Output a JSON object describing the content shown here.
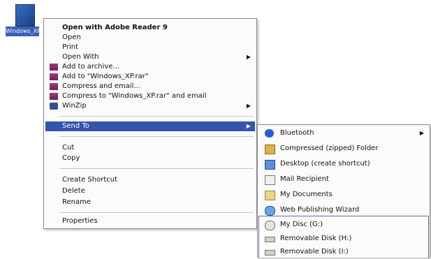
{
  "desktop_icon": {
    "label": "Windows_XP"
  },
  "context_menu": {
    "items": [
      {
        "label": "Open with Adobe Reader 9",
        "bold": true
      },
      {
        "label": "Open"
      },
      {
        "label": "Print"
      },
      {
        "label": "Open With",
        "submenu": true
      },
      {
        "label": "Add to archive...",
        "icon": "winrar-archive-icon"
      },
      {
        "label": "Add to \"Windows_XP.rar\"",
        "icon": "winrar-archive-icon"
      },
      {
        "label": "Compress and email...",
        "icon": "winrar-archive-icon"
      },
      {
        "label": "Compress to \"Windows_XP.rar\" and email",
        "icon": "winrar-archive-icon"
      },
      {
        "label": "WinZip",
        "icon": "winzip-icon",
        "submenu": true
      },
      {
        "label": "Send To",
        "submenu": true,
        "highlighted": true
      },
      {
        "label": "Cut"
      },
      {
        "label": "Copy"
      },
      {
        "label": "Create Shortcut"
      },
      {
        "label": "Delete"
      },
      {
        "label": "Rename"
      },
      {
        "label": "Properties"
      }
    ]
  },
  "send_to_menu": {
    "items": [
      {
        "label": "Bluetooth",
        "icon": "bluetooth-icon",
        "submenu": true
      },
      {
        "label": "Compressed (zipped) Folder",
        "icon": "zip-folder-icon"
      },
      {
        "label": "Desktop (create shortcut)",
        "icon": "desktop-icon"
      },
      {
        "label": "Mail Recipient",
        "icon": "mail-icon"
      },
      {
        "label": "My Documents",
        "icon": "folder-icon"
      },
      {
        "label": "Web Publishing Wizard",
        "icon": "web-publish-icon"
      },
      {
        "label": "My Disc (G:)",
        "icon": "disc-drive-icon"
      },
      {
        "label": "Removable Disk (H:)",
        "icon": "removable-disk-icon"
      },
      {
        "label": "Removable Disk (I:)",
        "icon": "removable-disk-icon"
      }
    ]
  },
  "colors": {
    "highlight": "#3355aa",
    "menu_bg": "#fbfbfb",
    "drive_box_border": "#7b5fa8"
  }
}
